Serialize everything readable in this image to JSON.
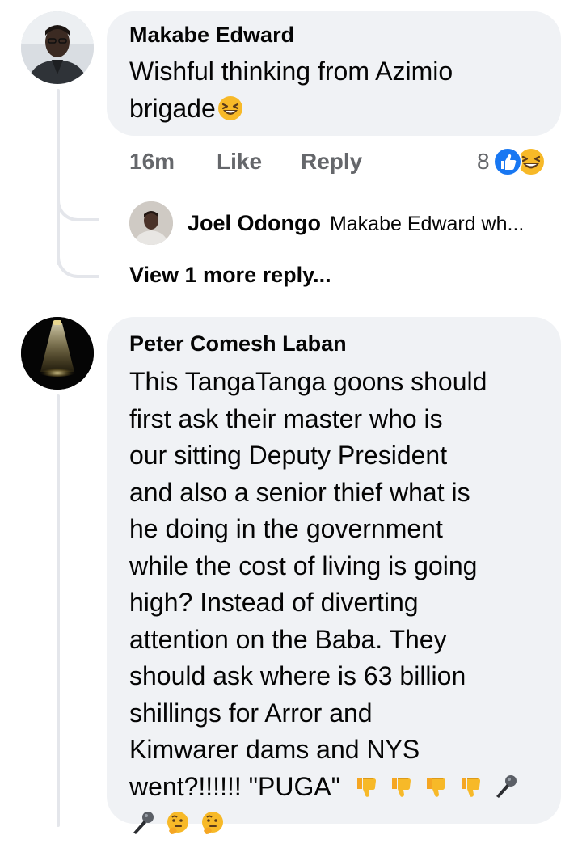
{
  "comments": [
    {
      "author": "Makabe Edward",
      "text": "Wishful thinking from Azimio brigade",
      "text_line1": "Wishful thinking from Azimio",
      "text_line2": "brigade",
      "trailing_emoji": "laughing-squinting-emoji",
      "time": "16m",
      "like_label": "Like",
      "reply_label": "Reply",
      "reaction_count": "8",
      "reactions": [
        "like-reaction-icon",
        "haha-reaction-icon"
      ],
      "replies": [
        {
          "author": "Joel Odongo",
          "preview": "Makabe Edward wh..."
        }
      ],
      "view_more_label": "View 1 more reply..."
    },
    {
      "author": "Peter Comesh Laban",
      "lines": [
        "This TangaTanga goons should",
        "first ask their master who is",
        "our sitting Deputy President",
        "and also a senior thief what is",
        "he doing in the government",
        "while the cost of living is going",
        "high? Instead of diverting",
        "attention on the Baba. They",
        "should ask where is 63 billion",
        "shillings for Arror and",
        "Kimwarer dams and NYS"
      ],
      "last_line_text": "went?!!!!!! \"PUGA\"",
      "emojis": [
        "thumbs-down-emoji",
        "thumbs-down-emoji",
        "thumbs-down-emoji",
        "thumbs-down-emoji",
        "microphone-emoji",
        "microphone-emoji",
        "thinking-face-emoji",
        "thinking-face-emoji"
      ]
    }
  ],
  "colors": {
    "bubble": "#f0f2f5",
    "thread_line": "#e4e6eb",
    "meta_text": "#65676b",
    "like_blue": "#1877f2",
    "haha_yellow": "#f7b928"
  }
}
